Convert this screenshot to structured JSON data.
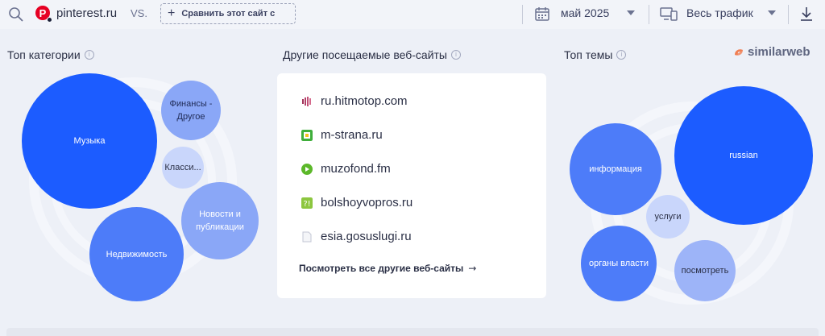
{
  "topbar": {
    "site": "pinterest.ru",
    "site_logo_letter": "P",
    "vs": "VS.",
    "compare_label": "Сравнить этот сайт с",
    "date": "май 2025",
    "traffic": "Весь трафик"
  },
  "brand": "similarweb",
  "categories": {
    "title": "Топ категории",
    "items": [
      "Музыка",
      "Финансы - Другое",
      "Класси...",
      "Новости и публикации",
      "Недвижимость"
    ]
  },
  "websites": {
    "title": "Другие посещаемые веб-сайты",
    "items": [
      "ru.hitmotop.com",
      "m-strana.ru",
      "muzofond.fm",
      "bolshoyvopros.ru",
      "esia.gosuslugi.ru"
    ],
    "see_all": "Посмотреть все другие веб-сайты"
  },
  "topics": {
    "title": "Топ темы",
    "items": [
      "russian",
      "информация",
      "услуги",
      "органы власти",
      "посмотреть"
    ]
  },
  "colors": {
    "accent": "#1c5cff",
    "brand_orange": "#f07e52",
    "pinterest": "#e60023"
  }
}
